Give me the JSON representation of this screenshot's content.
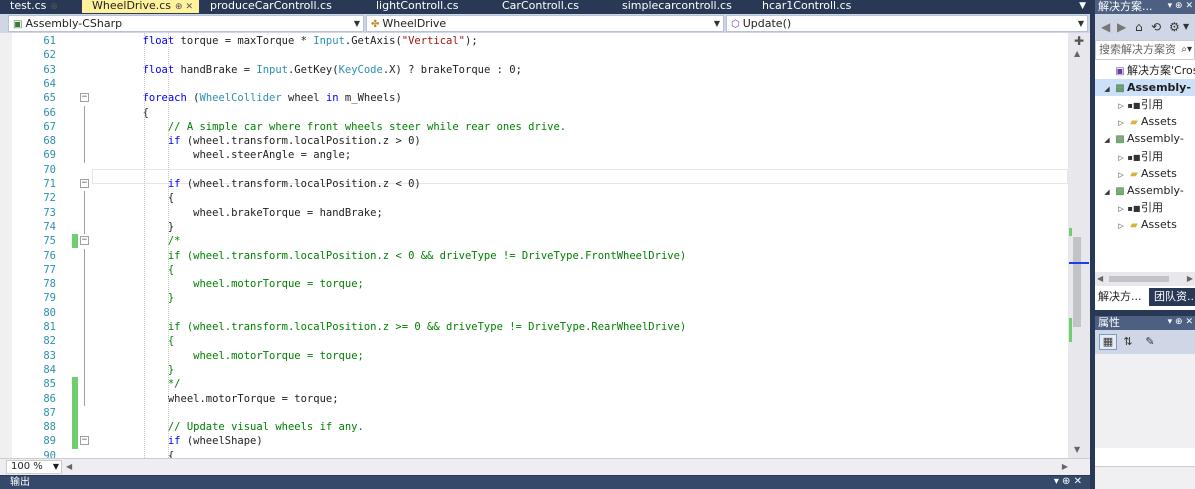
{
  "tabs": [
    {
      "label": "test.cs",
      "pin": "⊕",
      "active": false
    },
    {
      "label": "WheelDrive.cs",
      "pin": "⊕ ✕",
      "active": true
    },
    {
      "label": "produceCarControll.cs",
      "active": false
    },
    {
      "label": "lightControll.cs",
      "active": false
    },
    {
      "label": "CarControll.cs",
      "active": false
    },
    {
      "label": "simplecarcontroll.cs",
      "active": false
    },
    {
      "label": "hcar1Controll.cs",
      "active": false
    }
  ],
  "navbar": {
    "project": "Assembly-CSharp",
    "class": "WheelDrive",
    "member": "Update()"
  },
  "code": {
    "lines": [
      {
        "n": "61",
        "tokens": [
          [
            "",
            "        "
          ],
          [
            "kw",
            "float"
          ],
          [
            "",
            " torque = maxTorque * "
          ],
          [
            "type",
            "Input"
          ],
          [
            "",
            ".GetAxis("
          ],
          [
            "str",
            "\"Vertical\""
          ],
          [
            "",
            ");"
          ]
        ]
      },
      {
        "n": "62",
        "tokens": [
          [
            "",
            ""
          ]
        ]
      },
      {
        "n": "63",
        "tokens": [
          [
            "",
            "        "
          ],
          [
            "kw",
            "float"
          ],
          [
            "",
            " handBrake = "
          ],
          [
            "type",
            "Input"
          ],
          [
            "",
            ".GetKey("
          ],
          [
            "type",
            "KeyCode"
          ],
          [
            "",
            ".X) ? brakeTorque : 0;"
          ]
        ]
      },
      {
        "n": "64",
        "tokens": [
          [
            "",
            ""
          ]
        ]
      },
      {
        "n": "65",
        "tokens": [
          [
            "",
            "        "
          ],
          [
            "kw",
            "foreach"
          ],
          [
            "",
            " ("
          ],
          [
            "type",
            "WheelCollider"
          ],
          [
            "",
            " wheel "
          ],
          [
            "kw",
            "in"
          ],
          [
            "",
            " m_Wheels)"
          ]
        ]
      },
      {
        "n": "66",
        "tokens": [
          [
            "",
            "        {"
          ]
        ]
      },
      {
        "n": "67",
        "tokens": [
          [
            "",
            "            "
          ],
          [
            "cmt",
            "// A simple car where front wheels steer while rear ones drive."
          ]
        ]
      },
      {
        "n": "68",
        "tokens": [
          [
            "",
            "            "
          ],
          [
            "kw",
            "if"
          ],
          [
            "",
            " (wheel.transform.localPosition.z > 0)"
          ]
        ]
      },
      {
        "n": "69",
        "tokens": [
          [
            "",
            "                wheel.steerAngle = angle;"
          ]
        ]
      },
      {
        "n": "70",
        "tokens": [
          [
            "",
            ""
          ]
        ]
      },
      {
        "n": "71",
        "tokens": [
          [
            "",
            "            "
          ],
          [
            "kw",
            "if"
          ],
          [
            "",
            " (wheel.transform.localPosition.z < 0)"
          ]
        ]
      },
      {
        "n": "72",
        "tokens": [
          [
            "",
            "            {"
          ]
        ]
      },
      {
        "n": "73",
        "tokens": [
          [
            "",
            "                wheel.brakeTorque = handBrake;"
          ]
        ]
      },
      {
        "n": "74",
        "tokens": [
          [
            "",
            "            }"
          ]
        ]
      },
      {
        "n": "75",
        "tokens": [
          [
            "",
            "            "
          ],
          [
            "cmt",
            "/*"
          ]
        ]
      },
      {
        "n": "76",
        "tokens": [
          [
            "",
            "            "
          ],
          [
            "cmt",
            "if (wheel.transform.localPosition.z < 0 && driveType != DriveType.FrontWheelDrive)"
          ]
        ]
      },
      {
        "n": "77",
        "tokens": [
          [
            "",
            "            "
          ],
          [
            "cmt",
            "{"
          ]
        ]
      },
      {
        "n": "78",
        "tokens": [
          [
            "",
            "                "
          ],
          [
            "cmt",
            "wheel.motorTorque = torque;"
          ]
        ]
      },
      {
        "n": "79",
        "tokens": [
          [
            "",
            "            "
          ],
          [
            "cmt",
            "}"
          ]
        ]
      },
      {
        "n": "80",
        "tokens": [
          [
            "",
            ""
          ]
        ]
      },
      {
        "n": "81",
        "tokens": [
          [
            "",
            "            "
          ],
          [
            "cmt",
            "if (wheel.transform.localPosition.z >= 0 && driveType != DriveType.RearWheelDrive)"
          ]
        ]
      },
      {
        "n": "82",
        "tokens": [
          [
            "",
            "            "
          ],
          [
            "cmt",
            "{"
          ]
        ]
      },
      {
        "n": "83",
        "tokens": [
          [
            "",
            "                "
          ],
          [
            "cmt",
            "wheel.motorTorque = torque;"
          ]
        ]
      },
      {
        "n": "84",
        "tokens": [
          [
            "",
            "            "
          ],
          [
            "cmt",
            "}"
          ]
        ]
      },
      {
        "n": "85",
        "tokens": [
          [
            "",
            "            "
          ],
          [
            "cmt",
            "*/"
          ]
        ]
      },
      {
        "n": "86",
        "tokens": [
          [
            "",
            "            wheel.motorTorque = torque;"
          ]
        ]
      },
      {
        "n": "87",
        "tokens": [
          [
            "",
            ""
          ]
        ]
      },
      {
        "n": "88",
        "tokens": [
          [
            "",
            "            "
          ],
          [
            "cmt",
            "// Update visual wheels if any."
          ]
        ]
      },
      {
        "n": "89",
        "tokens": [
          [
            "",
            "            "
          ],
          [
            "kw",
            "if"
          ],
          [
            "",
            " (wheelShape)"
          ]
        ]
      },
      {
        "n": "90",
        "tokens": [
          [
            "",
            "            {"
          ]
        ]
      }
    ]
  },
  "zoom": "100 %",
  "solution_explorer": {
    "title": "解决方案...",
    "search_placeholder": "搜索解决方案资",
    "tree": [
      {
        "label": "解决方案'Cross",
        "icon": "solution-icon",
        "level": 0,
        "expander": "",
        "bold": false
      },
      {
        "label": "Assembly-",
        "icon": "csharp-project-icon",
        "level": 0,
        "expander": "◢",
        "bold": true,
        "selected": true
      },
      {
        "label": "引用",
        "icon": "references-icon",
        "level": 1,
        "expander": "▷",
        "bold": false
      },
      {
        "label": "Assets",
        "icon": "folder-icon",
        "level": 1,
        "expander": "▷",
        "bold": false
      },
      {
        "label": "Assembly-",
        "icon": "csharp-project-icon",
        "level": 0,
        "expander": "◢",
        "bold": false
      },
      {
        "label": "引用",
        "icon": "references-icon",
        "level": 1,
        "expander": "▷",
        "bold": false
      },
      {
        "label": "Assets",
        "icon": "folder-icon",
        "level": 1,
        "expander": "▷",
        "bold": false
      },
      {
        "label": "Assembly-",
        "icon": "csharp-project-icon",
        "level": 0,
        "expander": "◢",
        "bold": false
      },
      {
        "label": "引用",
        "icon": "references-icon",
        "level": 1,
        "expander": "▷",
        "bold": false
      },
      {
        "label": "Assets",
        "icon": "folder-icon",
        "level": 1,
        "expander": "▷",
        "bold": false
      }
    ],
    "tabs": [
      {
        "label": "解决方...",
        "active": true
      },
      {
        "label": "团队资...",
        "active": false
      }
    ]
  },
  "properties": {
    "title": "属性"
  },
  "bottom_panel": {
    "label": "输出"
  },
  "colors": {
    "chrome": "#293955",
    "active_tab": "#fff29d",
    "keyword": "#0000ff",
    "type": "#2b91af",
    "string": "#a31515",
    "comment": "#008000",
    "change_mark": "#6fcf6f"
  }
}
